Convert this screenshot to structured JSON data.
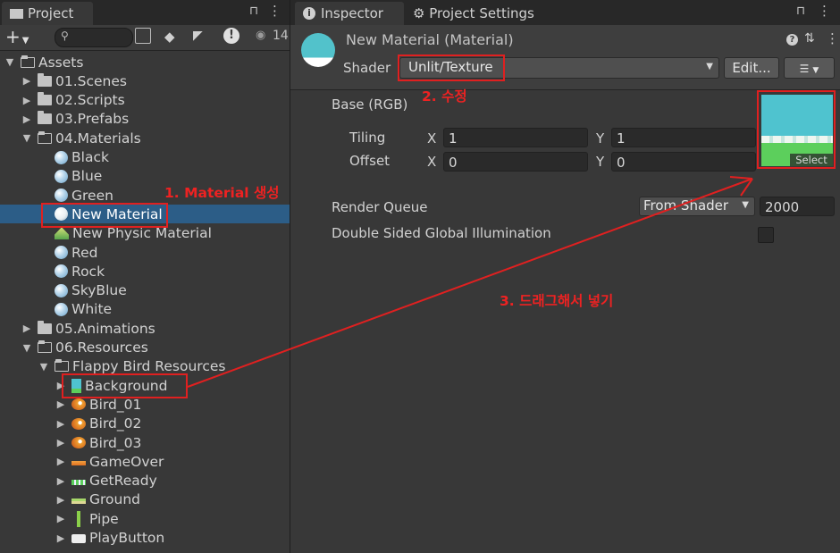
{
  "project": {
    "tab_label": "Project",
    "search_placeholder": "",
    "hidden_count": "14",
    "tree": [
      {
        "label": "Assets",
        "arrow": "▼",
        "icon": "folder-open"
      },
      {
        "label": "01.Scenes",
        "arrow": "▶",
        "icon": "folder"
      },
      {
        "label": "02.Scripts",
        "arrow": "▶",
        "icon": "folder"
      },
      {
        "label": "03.Prefabs",
        "arrow": "▶",
        "icon": "folder"
      },
      {
        "label": "04.Materials",
        "arrow": "▼",
        "icon": "folder-open"
      },
      {
        "label": "Black",
        "arrow": "",
        "icon": "material"
      },
      {
        "label": "Blue",
        "arrow": "",
        "icon": "material"
      },
      {
        "label": "Green",
        "arrow": "",
        "icon": "material"
      },
      {
        "label": "New Material",
        "arrow": "",
        "icon": "material",
        "selected": true
      },
      {
        "label": "New Physic Material",
        "arrow": "",
        "icon": "physic-material"
      },
      {
        "label": "Red",
        "arrow": "",
        "icon": "material"
      },
      {
        "label": "Rock",
        "arrow": "",
        "icon": "material"
      },
      {
        "label": "SkyBlue",
        "arrow": "",
        "icon": "material"
      },
      {
        "label": "White",
        "arrow": "",
        "icon": "material"
      },
      {
        "label": "05.Animations",
        "arrow": "▶",
        "icon": "folder"
      },
      {
        "label": "06.Resources",
        "arrow": "▼",
        "icon": "folder-open"
      },
      {
        "label": "Flappy Bird Resources",
        "arrow": "▼",
        "icon": "folder-open"
      },
      {
        "label": "Background",
        "arrow": "▶",
        "icon": "sprite-background"
      },
      {
        "label": "Bird_01",
        "arrow": "▶",
        "icon": "sprite-bird"
      },
      {
        "label": "Bird_02",
        "arrow": "▶",
        "icon": "sprite-bird"
      },
      {
        "label": "Bird_03",
        "arrow": "▶",
        "icon": "sprite-bird"
      },
      {
        "label": "GameOver",
        "arrow": "▶",
        "icon": "sprite-gameover"
      },
      {
        "label": "GetReady",
        "arrow": "▶",
        "icon": "sprite-getready"
      },
      {
        "label": "Ground",
        "arrow": "▶",
        "icon": "sprite-ground"
      },
      {
        "label": "Pipe",
        "arrow": "▶",
        "icon": "sprite-pipe"
      },
      {
        "label": "PlayButton",
        "arrow": "▶",
        "icon": "sprite-playbutton"
      }
    ]
  },
  "inspector": {
    "tab_label": "Inspector",
    "settings_tab_label": "Project Settings",
    "title": "New Material (Material)",
    "shader_label": "Shader",
    "shader_value": "Unlit/Texture",
    "edit_button": "Edit...",
    "base_label": "Base (RGB)",
    "tiling_label": "Tiling",
    "offset_label": "Offset",
    "x_label": "X",
    "y_label": "Y",
    "tiling_x": "1",
    "tiling_y": "1",
    "offset_x": "0",
    "offset_y": "0",
    "select_label": "Select",
    "render_queue_label": "Render Queue",
    "render_queue_mode": "From Shader",
    "render_queue_value": "2000",
    "double_sided_label": "Double Sided Global Illumination",
    "double_sided_checked": false
  },
  "annotations": {
    "step1": "1. Material 생성",
    "step2": "2. 수정",
    "step3": "3. 드래그해서 넣기",
    "color": "#e02020"
  },
  "colors": {
    "selection": "#2c5d87",
    "panel": "#383838",
    "texture_sky": "#4fc3cf",
    "texture_grass": "#5ccf5c"
  }
}
